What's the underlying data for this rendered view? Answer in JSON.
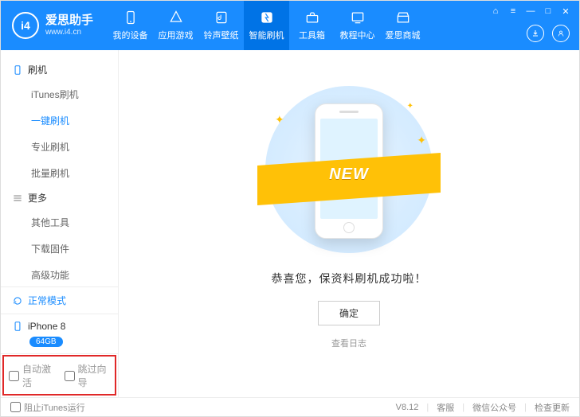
{
  "brand": {
    "name": "爱思助手",
    "url": "www.i4.cn",
    "logo_text": "i4"
  },
  "window_buttons": {
    "cart": "⌂",
    "menu": "≡",
    "min": "—",
    "max": "□",
    "close": "✕"
  },
  "header_circles": {
    "download": "↓",
    "user": "◯"
  },
  "top_nav": [
    {
      "label": "我的设备",
      "icon": "device"
    },
    {
      "label": "应用游戏",
      "icon": "apps"
    },
    {
      "label": "铃声壁纸",
      "icon": "music"
    },
    {
      "label": "智能刷机",
      "icon": "flash",
      "active": true
    },
    {
      "label": "工具箱",
      "icon": "toolbox"
    },
    {
      "label": "教程中心",
      "icon": "tutorial"
    },
    {
      "label": "爱思商城",
      "icon": "store"
    }
  ],
  "sidebar": {
    "group1": {
      "title": "刷机"
    },
    "items1": [
      {
        "label": "iTunes刷机"
      },
      {
        "label": "一键刷机",
        "active": true
      },
      {
        "label": "专业刷机"
      },
      {
        "label": "批量刷机"
      }
    ],
    "group2": {
      "title": "更多"
    },
    "items2": [
      {
        "label": "其他工具"
      },
      {
        "label": "下载固件"
      },
      {
        "label": "高级功能"
      }
    ],
    "status": {
      "label": "正常模式"
    },
    "device": {
      "name": "iPhone 8",
      "storage": "64GB"
    },
    "options": [
      {
        "label": "自动激活",
        "checked": false
      },
      {
        "label": "跳过向导",
        "checked": false
      }
    ]
  },
  "main": {
    "ribbon": "NEW",
    "message": "恭喜您，保资料刷机成功啦！",
    "confirm": "确定",
    "log_link": "查看日志"
  },
  "footer": {
    "block_itunes": "阻止iTunes运行",
    "version": "V8.12",
    "support": "客服",
    "wechat": "微信公众号",
    "update": "检查更新"
  }
}
